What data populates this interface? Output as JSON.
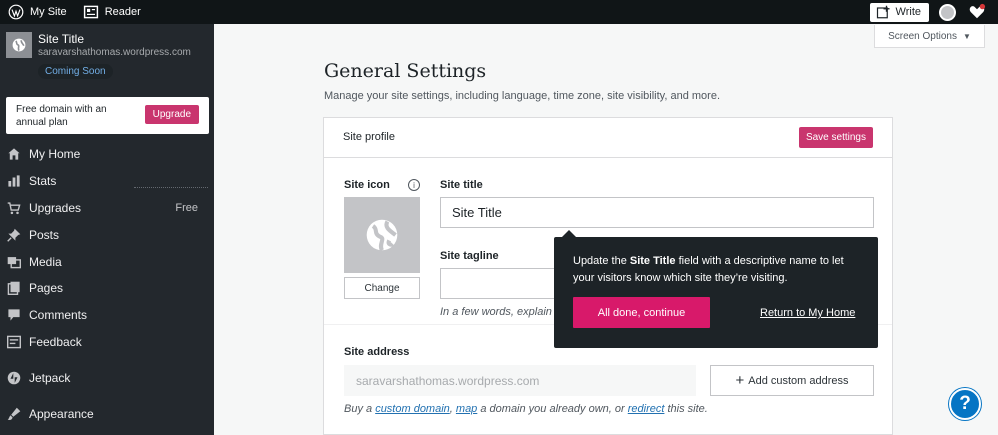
{
  "masterbar": {
    "my_site": "My Site",
    "reader": "Reader",
    "write": "Write"
  },
  "sidebar": {
    "site_title": "Site Title",
    "site_url": "saravarshathomas.wordpress.com",
    "badge": "Coming Soon",
    "upsell_text": "Free domain with an annual plan",
    "upgrade_label": "Upgrade",
    "items": [
      {
        "label": "My Home",
        "icon": "home-icon"
      },
      {
        "label": "Stats",
        "icon": "stats-icon"
      },
      {
        "label": "Upgrades",
        "icon": "cart-icon",
        "badge": "Free"
      },
      {
        "label": "Posts",
        "icon": "pin-icon"
      },
      {
        "label": "Media",
        "icon": "media-icon"
      },
      {
        "label": "Pages",
        "icon": "pages-icon"
      },
      {
        "label": "Comments",
        "icon": "comments-icon"
      },
      {
        "label": "Feedback",
        "icon": "feedback-icon"
      },
      {
        "label": "Jetpack",
        "icon": "jetpack-icon"
      },
      {
        "label": "Appearance",
        "icon": "appearance-icon"
      }
    ]
  },
  "screen_options": "Screen Options",
  "page": {
    "title": "General Settings",
    "subtitle": "Manage your site settings, including language, time zone, site visibility, and more."
  },
  "card": {
    "header_title": "Site profile",
    "save_label": "Save settings",
    "site_icon_label": "Site icon",
    "change_label": "Change",
    "site_title_label": "Site title",
    "site_title_value": "Site Title",
    "tagline_label": "Site tagline",
    "tagline_value": "",
    "tagline_hint": "In a few words, explain",
    "address_label": "Site address",
    "address_value": "saravarshathomas.wordpress.com",
    "add_domain_label": "Add custom address",
    "addr_hint": {
      "prefix": "Buy a ",
      "custom_domain": "custom domain",
      "sep1": ", ",
      "map": "map",
      "mid": " a domain you already own, or ",
      "redirect": "redirect",
      "suffix": " this site."
    }
  },
  "tooltip": {
    "pre": "Update the ",
    "bold": "Site Title",
    "post": " field with a descriptive name to let your visitors know which site they’re visiting.",
    "continue_label": "All done, continue",
    "return_label": "Return to My Home"
  },
  "help": "?",
  "colors": {
    "accent": "#c9356e",
    "sidebar_bg": "#23282d",
    "masterbar_bg": "#101517",
    "link": "#2271b1",
    "help": "#0675c4"
  }
}
